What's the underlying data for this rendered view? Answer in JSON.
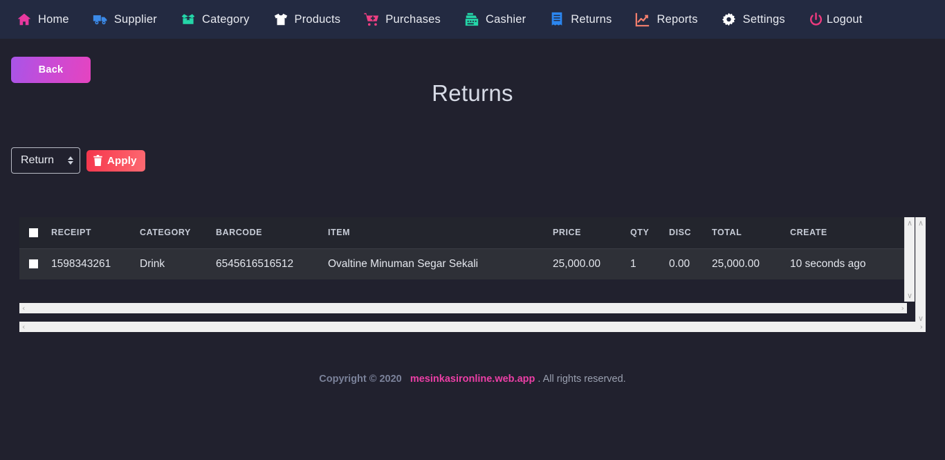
{
  "navbar": {
    "items": [
      {
        "label": "Home",
        "icon": "home-icon",
        "color": "#e8399f"
      },
      {
        "label": "Supplier",
        "icon": "truck-icon",
        "color": "#3b8ae8"
      },
      {
        "label": "Category",
        "icon": "box-open-icon",
        "color": "#24d6a8"
      },
      {
        "label": "Products",
        "icon": "tshirt-icon",
        "color": "#ffffff"
      },
      {
        "label": "Purchases",
        "icon": "cart-plus-icon",
        "color": "#ee3f82"
      },
      {
        "label": "Cashier",
        "icon": "cash-register-icon",
        "color": "#24d6a8"
      },
      {
        "label": "Returns",
        "icon": "receipt-icon",
        "color": "#2b86ef"
      },
      {
        "label": "Reports",
        "icon": "chart-line-icon",
        "color": "#f7806e"
      },
      {
        "label": "Settings",
        "icon": "gear-icon",
        "color": "#ffffff"
      },
      {
        "label": "Logout",
        "icon": "power-icon",
        "color": "#ec3a7e"
      }
    ]
  },
  "page": {
    "back_label": "Back",
    "title": "Returns"
  },
  "filter": {
    "select_value": "Return",
    "select_options": [
      "Return"
    ],
    "apply_label": "Apply",
    "apply_icon": "trash-icon"
  },
  "table": {
    "columns": [
      {
        "key": "check",
        "label": ""
      },
      {
        "key": "receipt",
        "label": "RECEIPT"
      },
      {
        "key": "category",
        "label": "CATEGORY"
      },
      {
        "key": "barcode",
        "label": "BARCODE"
      },
      {
        "key": "item",
        "label": "ITEM"
      },
      {
        "key": "price",
        "label": "PRICE"
      },
      {
        "key": "qty",
        "label": "QTY"
      },
      {
        "key": "disc",
        "label": "DISC"
      },
      {
        "key": "total",
        "label": "TOTAL"
      },
      {
        "key": "create",
        "label": "CREATE"
      }
    ],
    "rows": [
      {
        "receipt": "1598343261",
        "category": "Drink",
        "barcode": "6545616516512",
        "item": "Ovaltine Minuman Segar Sekali",
        "price": "25,000.00",
        "qty": "1",
        "disc": "0.00",
        "total": "25,000.00",
        "create": "10 seconds ago"
      }
    ]
  },
  "scrollbars": {
    "up_arrow": "∧",
    "down_arrow": "∨",
    "left_arrow": "‹",
    "right_arrow": "›"
  },
  "footer": {
    "copyright": "Copyright © 2020",
    "brand": "mesinkasironline.web.app",
    "rights": ". All rights reserved."
  },
  "colors": {
    "navbar_bg": "#232a41",
    "body_bg": "#21212e",
    "table_header_bg": "#23252d",
    "table_row_bg": "#2e3037",
    "back_gradient_from": "#a855e8",
    "back_gradient_to": "#e544c0",
    "apply_gradient_from": "#f4364c",
    "apply_gradient_to": "#fc6a72",
    "brand_pink": "#ec3fa6"
  }
}
